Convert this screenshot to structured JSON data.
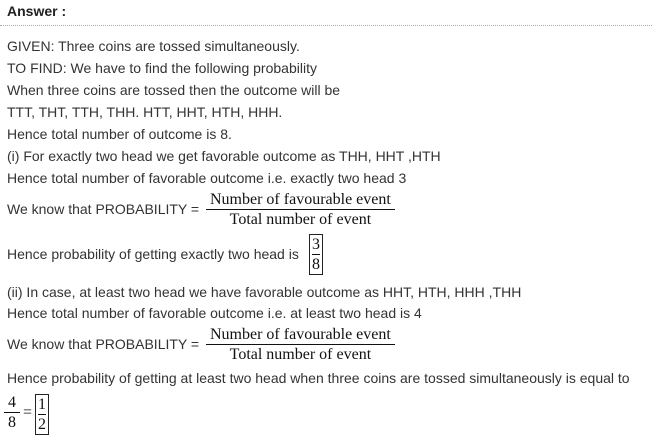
{
  "heading": "Answer :",
  "lines": {
    "given": "GIVEN: Three coins are tossed simultaneously.",
    "to_find": "TO FIND: We have to find the following probability",
    "outcome_intro": "When three coins are tossed then the outcome will be",
    "outcomes": "TTT, THT, TTH, THH. HTT, HHT, HTH, HHH.",
    "total_outcome": "Hence total number of outcome is 8.",
    "part1_intro": "(i) For exactly two head we get favorable outcome as THH, HHT ,HTH",
    "part1_total": "Hence total number of favorable outcome i.e. exactly two head 3",
    "part1_know": "We know that PROBABILITY =",
    "part1_result": "Hence probability of getting exactly two head is",
    "part2_intro": "(ii) In case, at least two head we have favorable outcome as HHT, HTH, HHH ,THH",
    "part2_total": "Hence total number of favorable outcome i.e. at least two head is 4",
    "part2_know": "We know that PROBABILITY =",
    "part2_result": "Hence probability of getting at least two head when three coins are tossed simultaneously is equal to"
  },
  "formula": {
    "numerator": "Number of favourable event",
    "denominator": "Total number of event"
  },
  "part1_answer": {
    "numerator": "3",
    "denominator": "8"
  },
  "part2_answer": {
    "unsimplified_numerator": "4",
    "unsimplified_denominator": "8",
    "equals": "=",
    "numerator": "1",
    "denominator": "2"
  }
}
